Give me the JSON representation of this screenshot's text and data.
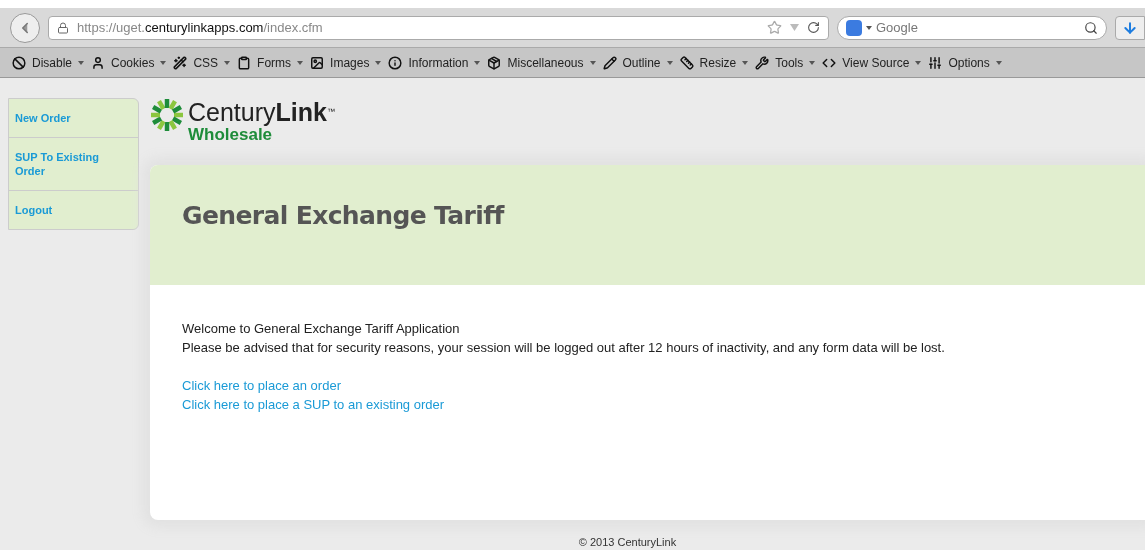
{
  "browser": {
    "url": {
      "prefix": "https://uget.",
      "host": "centurylinkapps.com",
      "path": "/index.cfm"
    },
    "search": {
      "placeholder": "Google"
    }
  },
  "toolbar": [
    "Disable",
    "Cookies",
    "CSS",
    "Forms",
    "Images",
    "Information",
    "Miscellaneous",
    "Outline",
    "Resize",
    "Tools",
    "View Source",
    "Options"
  ],
  "sidebar": {
    "items": [
      "New Order",
      "SUP To Existing Order",
      "Logout"
    ]
  },
  "logo": {
    "name": "Century**Link**",
    "trademark": "™",
    "subtitle": "Wholesale"
  },
  "page": {
    "title": "General Exchange Tariff",
    "intro": [
      "Welcome to General Exchange Tariff Application",
      "Please be advised that for security reasons, your session will be logged out after 12 hours of inactivity, and any form data will be lost."
    ],
    "links": [
      "Click here to place an order",
      "Click here to place a SUP to an existing order"
    ]
  },
  "footer": "© 2013 CenturyLink"
}
